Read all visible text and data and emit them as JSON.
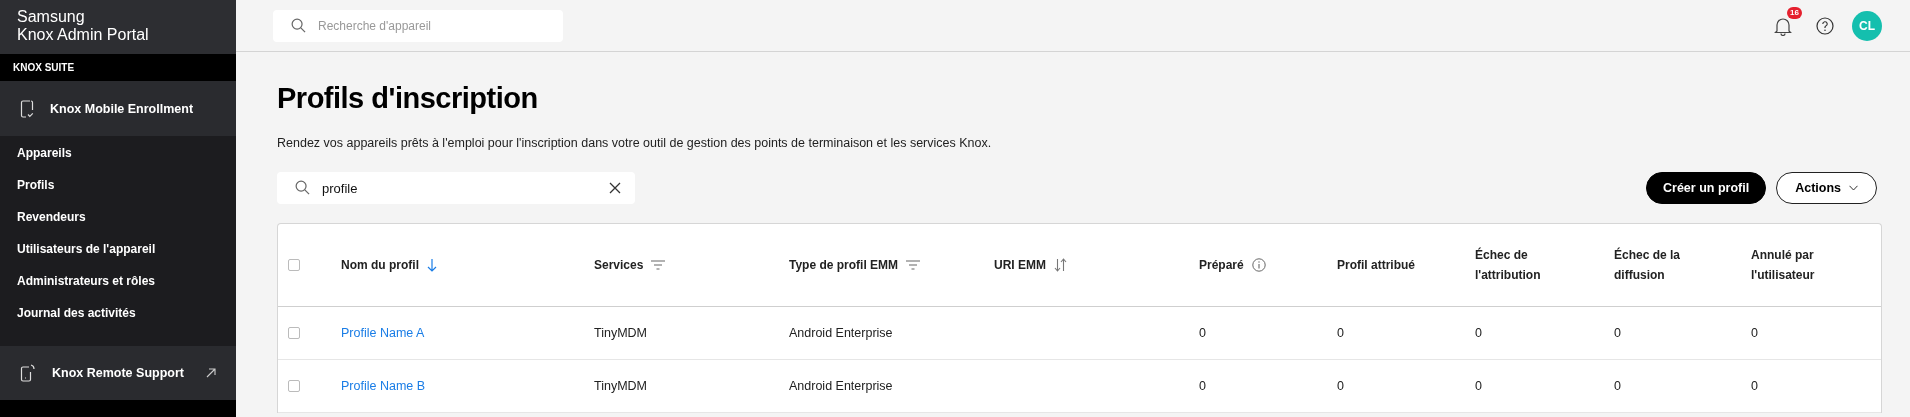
{
  "sidebar": {
    "brand": [
      "Samsung",
      "Knox Admin Portal"
    ],
    "suite_label": "KNOX SUITE",
    "product": {
      "label": "Knox Mobile Enrollment"
    },
    "items": [
      {
        "label": "Appareils"
      },
      {
        "label": "Profils"
      },
      {
        "label": "Revendeurs"
      },
      {
        "label": "Utilisateurs de l'appareil"
      },
      {
        "label": "Administrateurs et rôles"
      },
      {
        "label": "Journal des activités"
      }
    ],
    "external": {
      "label": "Knox Remote Support"
    }
  },
  "topbar": {
    "search": {
      "placeholder": "Recherche d'appareil"
    },
    "notifications": {
      "count": "16"
    },
    "avatar": {
      "initials": "CL"
    }
  },
  "page": {
    "title": "Profils d'inscription",
    "description": "Rendez vos appareils prêts à l'emploi pour l'inscription dans votre outil de gestion des points de terminaison et les services Knox.",
    "filter": {
      "value": "profile"
    },
    "buttons": [
      {
        "label": "Créer un profil",
        "kind": "primary"
      },
      {
        "label": "Actions",
        "kind": "menu"
      }
    ]
  },
  "table": {
    "select_all": {
      "checked": false
    },
    "columns": [
      {
        "label": "Nom du profil",
        "kind": "sort",
        "sorted": true
      },
      {
        "label": "Services",
        "kind": "filter"
      },
      {
        "label": "Type de profil EMM",
        "kind": "filter"
      },
      {
        "label": "URI EMM",
        "kind": "sort",
        "sorted": false
      },
      {
        "label": "Préparé",
        "kind": "info"
      },
      {
        "label": "Profil attribué",
        "kind": "plain"
      },
      {
        "label": "Échec de l'attribution",
        "kind": "plain"
      },
      {
        "label": "Échec de la diffusion",
        "kind": "plain"
      },
      {
        "label": "Annulé par l'utilisateur",
        "kind": "plain"
      }
    ],
    "rows": [
      {
        "checked": false,
        "cells": [
          "Profile Name A",
          "TinyMDM",
          "Android Enterprise",
          "",
          "0",
          "0",
          "0",
          "0",
          "0"
        ]
      },
      {
        "checked": false,
        "cells": [
          "Profile Name B",
          "TinyMDM",
          "Android Enterprise",
          "",
          "0",
          "0",
          "0",
          "0",
          "0"
        ]
      }
    ]
  }
}
